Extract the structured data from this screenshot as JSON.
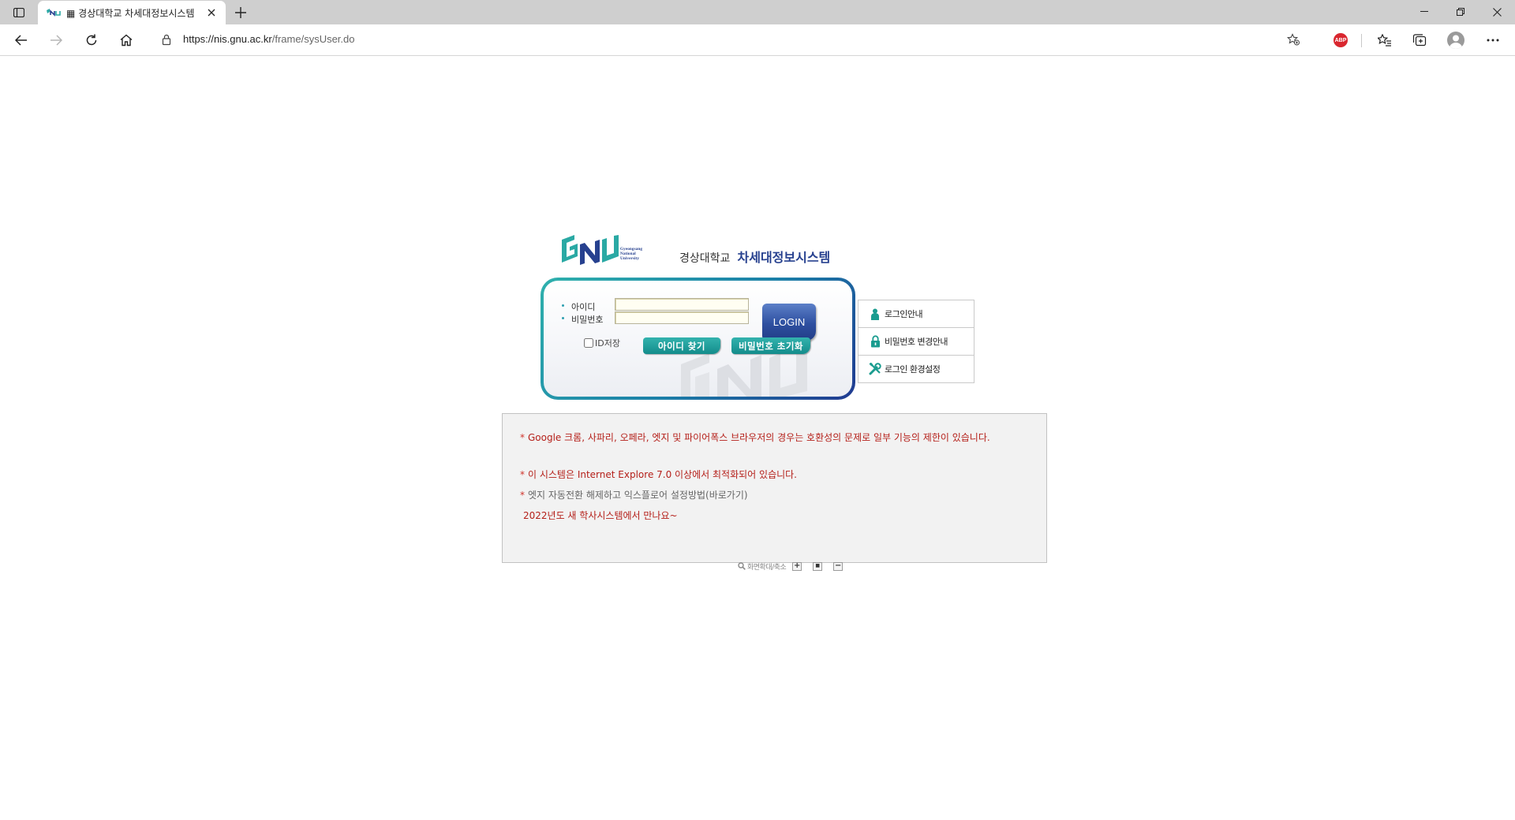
{
  "browser": {
    "tab": {
      "title": "▦ 경상대학교 차세대정보시스템",
      "favicon": "gnu-logo-icon"
    },
    "address": {
      "host": "https://nis.gnu.ac.kr",
      "path": "/frame/sysUser.do"
    },
    "extensions": [
      "ABP"
    ]
  },
  "logo": {
    "line1": "Gyeongsang",
    "line2": "National",
    "line3": "University",
    "univ_ko": "경상대학교",
    "system_ko": "차세대정보시스템",
    "brand_colors": {
      "teal": "#2aa9a4",
      "navy": "#27418f"
    }
  },
  "login": {
    "id_label": "아이디",
    "password_label": "비밀번호",
    "id_value": "",
    "password_value": "",
    "login_button": "LOGIN",
    "remember_label": "ID저장",
    "remember_checked": false,
    "find_id_button": "아이디 찾기",
    "reset_password_button": "비밀번호 초기화"
  },
  "side_menu": [
    {
      "label": "로그인안내",
      "icon": "person-icon"
    },
    {
      "label": "비밀번호 변경안내",
      "icon": "lock-icon"
    },
    {
      "label": "로그인 환경설정",
      "icon": "tools-icon"
    }
  ],
  "notices": {
    "browser_compat": "Google 크롬, 사파리, 오페라, 엣지 및 파이어폭스 브라우저의 경우는 호환성의 문제로 일부 기능의 제한이 있습니다.",
    "ie_optimized": "이 시스템은 Internet Explore 7.0 이상에서 최적화되어 있습니다.",
    "edge_link": "엣지 자동전환 해제하고 익스플로어 설정방법(바로가기)",
    "new_system": "2022년도 새 학사시스템에서 만나요~",
    "star": "*"
  },
  "zoom": {
    "label": "화면확대/축소",
    "plus": "+",
    "reset": "■",
    "minus": "−"
  }
}
